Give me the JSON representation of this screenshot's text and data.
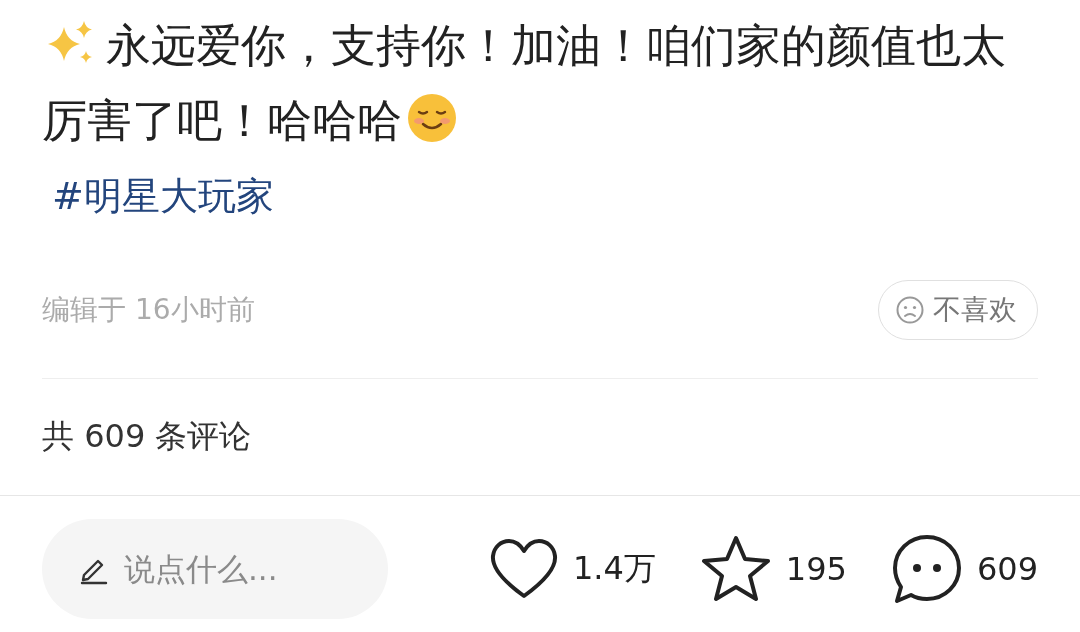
{
  "post": {
    "text_lines": [
      "永远爱你，支持你！加油！咱们家的颜值也太",
      "厉害了吧！哈哈哈"
    ],
    "hashtag": "#明星大玩家",
    "edited": "编辑于 16小时前",
    "dislike_label": "不喜欢"
  },
  "comments_count": "共 609 条评论",
  "bottom_bar": {
    "comment_field": {
      "placeholder": "说点什么..."
    },
    "likes": "1.4万",
    "favorites": "195",
    "comments": "609"
  }
}
